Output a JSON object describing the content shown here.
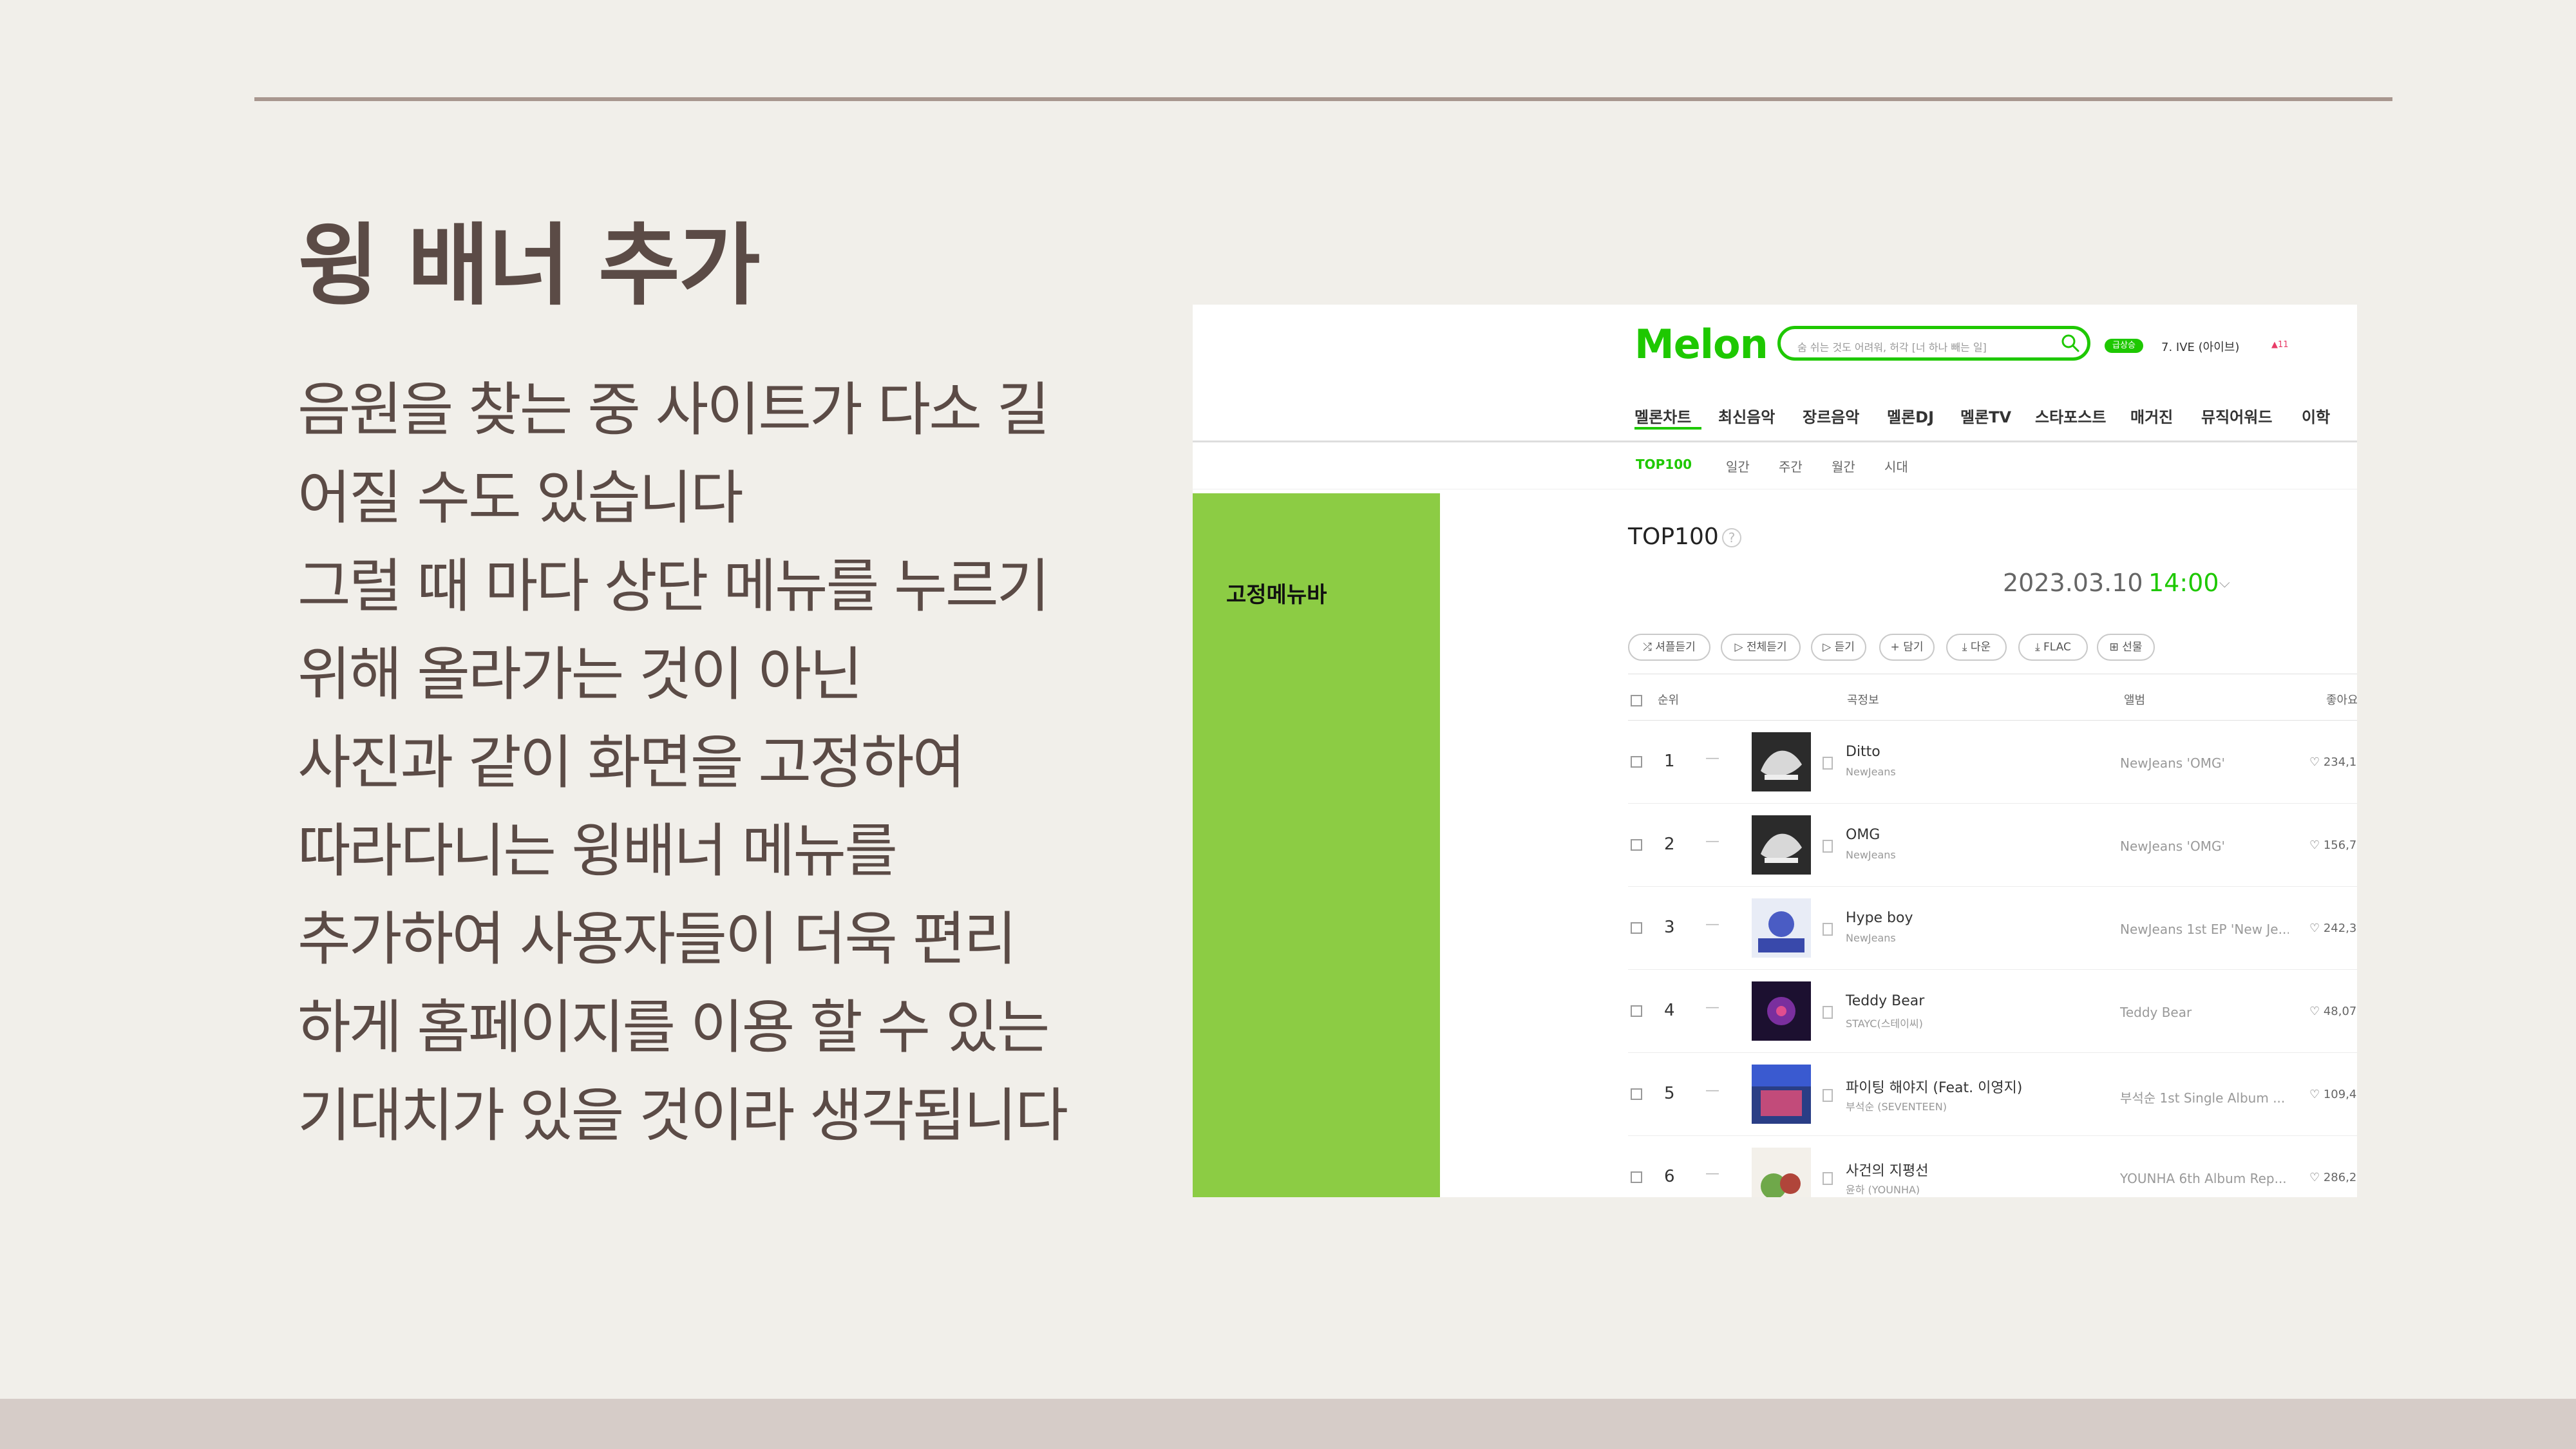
{
  "slide": {
    "title": "윙 배너 추가",
    "body_lines": [
      "음원을 찾는 중 사이트가 다소 길",
      "어질 수도 있습니다",
      "그럴 때 마다 상단 메뉴를 누르기",
      "위해 올라가는 것이 아닌",
      "사진과 같이 화면을 고정하여",
      "따라다니는 윙배너 메뉴를",
      "추가하여 사용자들이 더욱 편리",
      "하게 홈페이지를 이용 할 수 있는",
      "기대치가 있을 것이라 생각됩니다"
    ]
  },
  "screenshot": {
    "logo": "Melon",
    "search_placeholder": "숨 쉬는 것도 어려워, 허각 [너 하나 빼는 일]",
    "live_badge": "급상승",
    "rank_ticker": "7. IVE (아이브)",
    "rank_change": "▲11",
    "gnb": [
      "멜론차트",
      "최신음악",
      "장르음악",
      "멜론DJ",
      "멜론TV",
      "스타포스트",
      "매거진",
      "뮤직어워드",
      "이학"
    ],
    "lnb": [
      "TOP100",
      "일간",
      "주간",
      "월간",
      "시대"
    ],
    "sidebar_label": "고정메뉴바",
    "section_title": "TOP100",
    "help": "?",
    "date": "2023.03.10",
    "time": "14:00",
    "buttons": [
      "셔플듣기",
      "전체듣기",
      "듣기",
      "담기",
      "다운",
      "FLAC",
      "선물"
    ],
    "columns": {
      "rank": "순위",
      "info": "곡정보",
      "album": "앨범",
      "like": "좋아요"
    },
    "rows": [
      {
        "rank": "1",
        "dash": "—",
        "song": "Ditto",
        "artist": "NewJeans",
        "album": "NewJeans 'OMG'",
        "likes": "♡ 234,1"
      },
      {
        "rank": "2",
        "dash": "—",
        "song": "OMG",
        "artist": "NewJeans",
        "album": "NewJeans 'OMG'",
        "likes": "♡ 156,7"
      },
      {
        "rank": "3",
        "dash": "—",
        "song": "Hype boy",
        "artist": "NewJeans",
        "album": "NewJeans 1st EP 'New Je...",
        "likes": "♡ 242,3"
      },
      {
        "rank": "4",
        "dash": "—",
        "song": "Teddy Bear",
        "artist": "STAYC(스테이씨)",
        "album": "Teddy Bear",
        "likes": "♡ 48,07"
      },
      {
        "rank": "5",
        "dash": "—",
        "song": "파이팅 해야지 (Feat. 이영지)",
        "artist": "부석순 (SEVENTEEN)",
        "album": "부석순 1st Single Album ...",
        "likes": "♡ 109,4"
      },
      {
        "rank": "6",
        "dash": "—",
        "song": "사건의 지평선",
        "artist": "윤하 (YOUNHA)",
        "album": "YOUNHA 6th Album Rep...",
        "likes": "♡ 286,2"
      }
    ],
    "colors": {
      "brand": "#1ec800",
      "sidebar": "#8ccc44"
    }
  }
}
